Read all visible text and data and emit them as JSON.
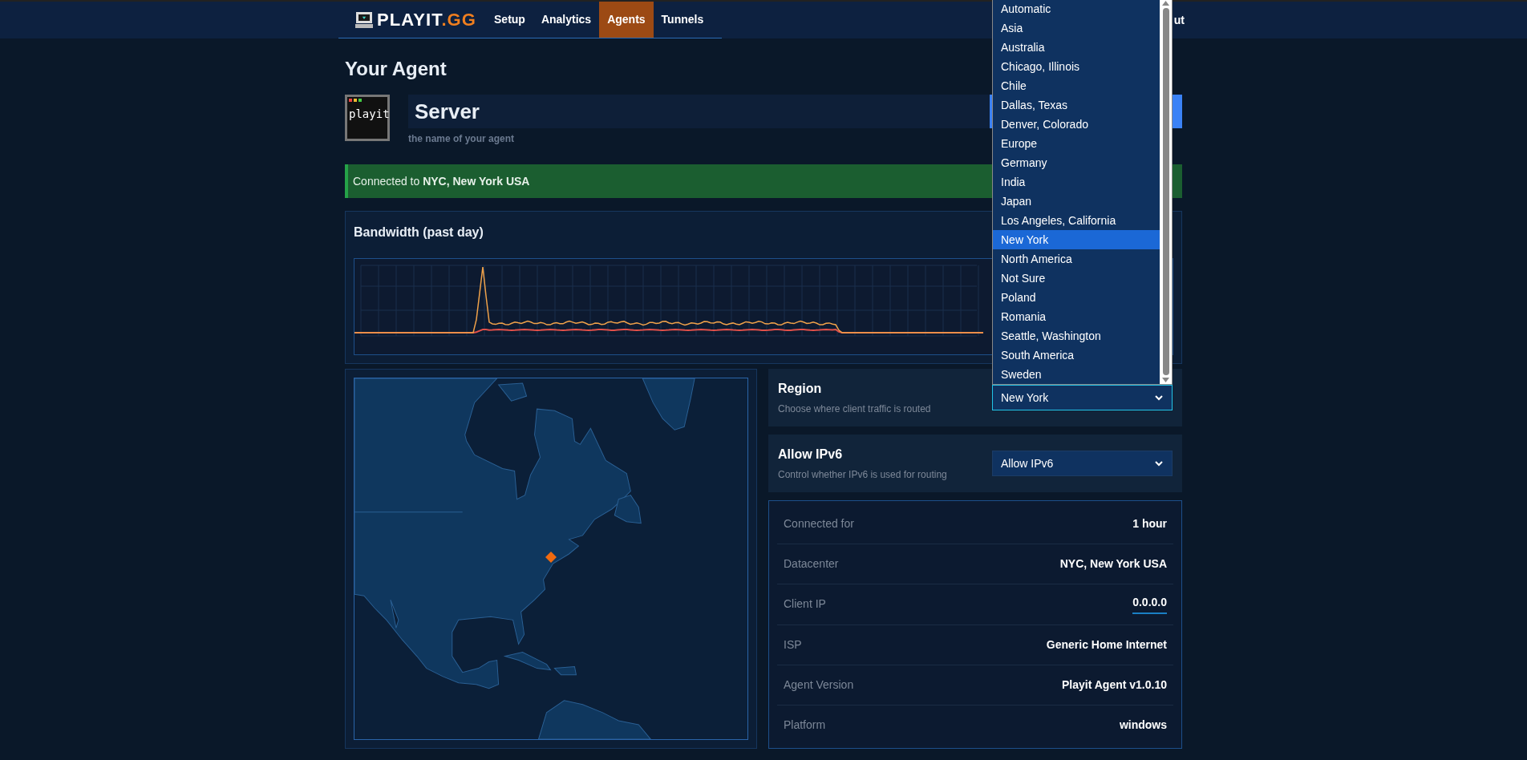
{
  "header": {
    "logo": {
      "text": "PLAYIT",
      "suffix": ".GG"
    },
    "nav": [
      {
        "label": "Setup",
        "selected": false
      },
      {
        "label": "Analytics",
        "selected": false
      },
      {
        "label": "Agents",
        "selected": true
      },
      {
        "label": "Tunnels",
        "selected": false
      }
    ],
    "right_link": "ut"
  },
  "page": {
    "title": "Your Agent"
  },
  "agent": {
    "icon_text": "playit",
    "name": "Server",
    "hint": "the name of your agent"
  },
  "alert": {
    "text": "Connected to **NYC, New York USA**"
  },
  "bandwidth": {
    "title": "Bandwidth (past day)"
  },
  "region": {
    "title": "Region",
    "description": "Choose where client traffic is routed",
    "value": "New York",
    "expanded": true,
    "options": [
      {
        "label": "Automatic",
        "selected": false
      },
      {
        "label": "Asia",
        "selected": false
      },
      {
        "label": "Australia",
        "selected": false
      },
      {
        "label": "Chicago, Illinois",
        "selected": false
      },
      {
        "label": "Chile",
        "selected": false
      },
      {
        "label": "Dallas, Texas",
        "selected": false
      },
      {
        "label": "Denver, Colorado",
        "selected": false
      },
      {
        "label": "Europe",
        "selected": false
      },
      {
        "label": "Germany",
        "selected": false
      },
      {
        "label": "India",
        "selected": false
      },
      {
        "label": "Japan",
        "selected": false
      },
      {
        "label": "Los Angeles, California",
        "selected": false
      },
      {
        "label": "New York",
        "selected": true
      },
      {
        "label": "North America",
        "selected": false
      },
      {
        "label": "Not Sure",
        "selected": false
      },
      {
        "label": "Poland",
        "selected": false
      },
      {
        "label": "Romania",
        "selected": false
      },
      {
        "label": "Seattle, Washington",
        "selected": false
      },
      {
        "label": "South America",
        "selected": false
      },
      {
        "label": "Sweden",
        "selected": false
      }
    ]
  },
  "ipv6": {
    "title": "Allow IPv6",
    "description": "Control whether IPv6 is used for routing",
    "value": "Allow IPv6"
  },
  "details": [
    {
      "label": "Connected for",
      "value": "1 hour",
      "kind": "text"
    },
    {
      "label": "Datacenter",
      "value": "NYC, New York USA",
      "kind": "text"
    },
    {
      "label": "Client IP",
      "value": "0.0.0.0",
      "kind": "link"
    },
    {
      "label": "ISP",
      "value": "Generic Home Internet",
      "kind": "text"
    },
    {
      "label": "Agent Version",
      "value": "Playit Agent v1.0.10",
      "kind": "text"
    },
    {
      "label": "Platform",
      "value": "windows",
      "kind": "text"
    }
  ]
}
